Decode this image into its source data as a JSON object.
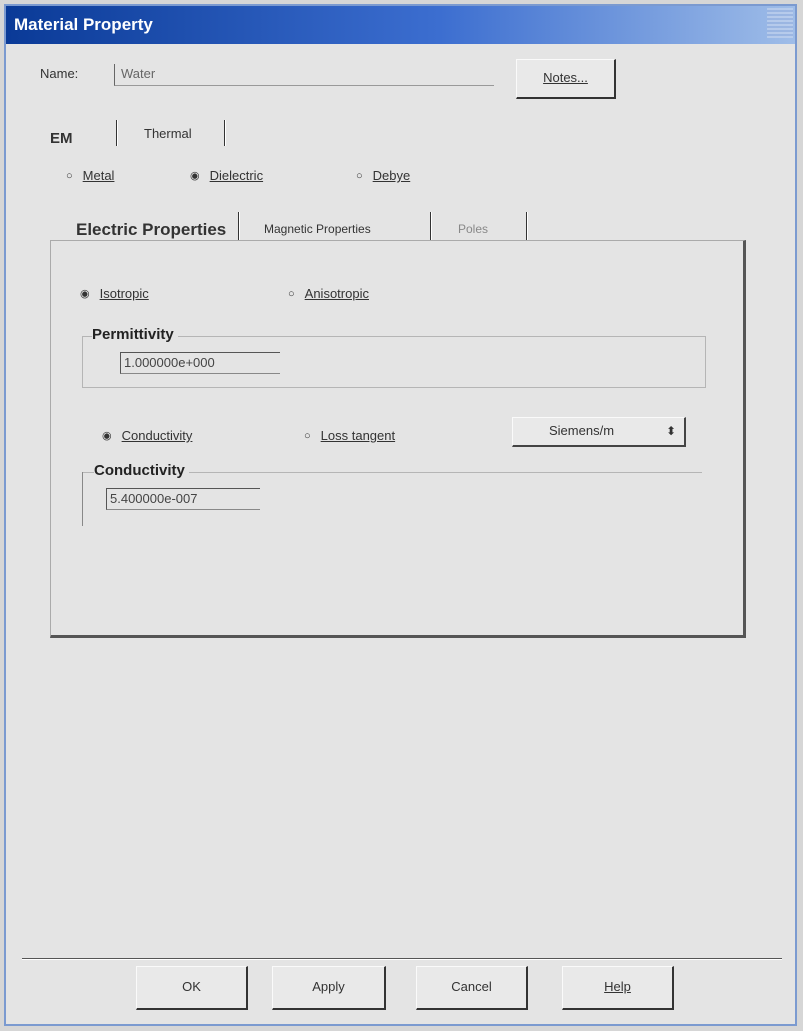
{
  "window": {
    "title": "Material Property"
  },
  "name_row": {
    "label": "Name:",
    "value": "Water",
    "notes_button": "Notes..."
  },
  "main_tabs": [
    {
      "label": "EM",
      "selected": true
    },
    {
      "label": "Thermal",
      "selected": false
    }
  ],
  "material_type": [
    {
      "label": "Metal",
      "selected": false
    },
    {
      "label": "Dielectric",
      "selected": true
    },
    {
      "label": "Debye",
      "selected": false
    }
  ],
  "property_tabs": [
    {
      "label": "Electric Properties",
      "selected": true
    },
    {
      "label": "Magnetic Properties",
      "selected": false
    },
    {
      "label": "Poles",
      "selected": false
    }
  ],
  "isotropy": [
    {
      "label": "Isotropic",
      "selected": true
    },
    {
      "label": "Anisotropic",
      "selected": false
    }
  ],
  "permittivity": {
    "group_title": "Permittivity",
    "value": "1.000000e+000"
  },
  "loss_mode": [
    {
      "label": "Conductivity",
      "selected": true
    },
    {
      "label": "Loss tangent",
      "selected": false
    }
  ],
  "units": {
    "selected": "Siemens/m"
  },
  "conductivity": {
    "group_title": "Conductivity",
    "value": "5.400000e-007"
  },
  "buttons": {
    "ok": "OK",
    "apply": "Apply",
    "cancel": "Cancel",
    "help": "Help"
  },
  "glyphs": {
    "radio_on": "◉",
    "radio_off": "○",
    "spinner": "⬍"
  },
  "colors": {
    "titlebar_start": "#0a3a97",
    "titlebar_end": "#9fbde8",
    "dialog_bg": "#e4e4e4"
  }
}
